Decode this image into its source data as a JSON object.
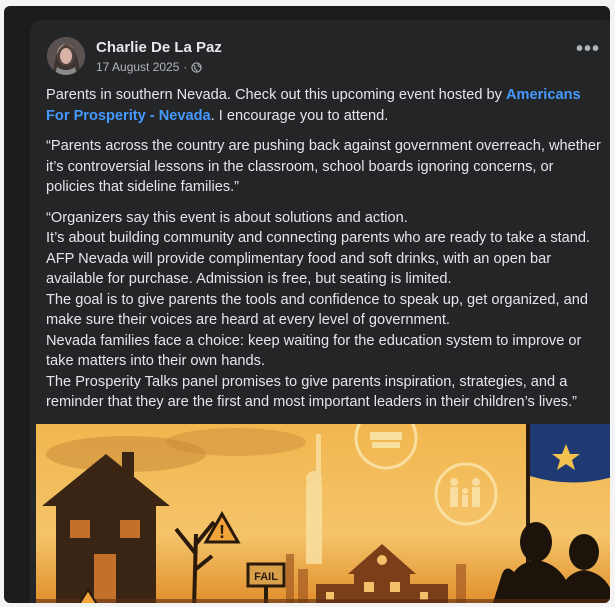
{
  "post": {
    "author": "Charlie De La Paz",
    "date": "17 August 2025",
    "separator": "·",
    "audience_icon": "globe-icon",
    "more_icon": "more-options-icon",
    "more_label": "•••",
    "intro": {
      "pre_link": "Parents in southern Nevada. Check out this upcoming event hosted by ",
      "link": "Americans For Prosperity - Nevada",
      "post_link": ". I encourage you to attend."
    },
    "quote1": "“Parents across the country are pushing back against government overreach, whether it’s controversial lessons in the classroom, school boards ignoring concerns, or policies that sideline families.”",
    "quote2_lines": [
      "“Organizers say this event is about solutions and action.",
      "It’s about building community and connecting parents who are ready to take a stand.",
      "AFP Nevada will provide complimentary food and soft drinks, with an open bar available for purchase. Admission is free, but seating is limited.",
      "The goal is to give parents the tools and confidence to speak up, get organized, and make sure their voices are heard at every level of government.",
      "Nevada families face a choice: keep waiting for the education system to improve or take matters into their own hands.",
      "The Prosperity Talks panel promises to give parents inspiration, strategies, and a reminder that they are the first and most important leaders in their children’s lives.”"
    ]
  },
  "image": {
    "sign_text": "FAIL",
    "colors": {
      "sky_top": "#f6c25a",
      "sky_bottom": "#e28a1f",
      "silhouette": "#1c130b",
      "flag": "#1f3a73"
    }
  },
  "colors": {
    "card": "#242526",
    "text": "#e4e6eb",
    "muted": "#b0b3b8",
    "link": "#4599ff"
  }
}
